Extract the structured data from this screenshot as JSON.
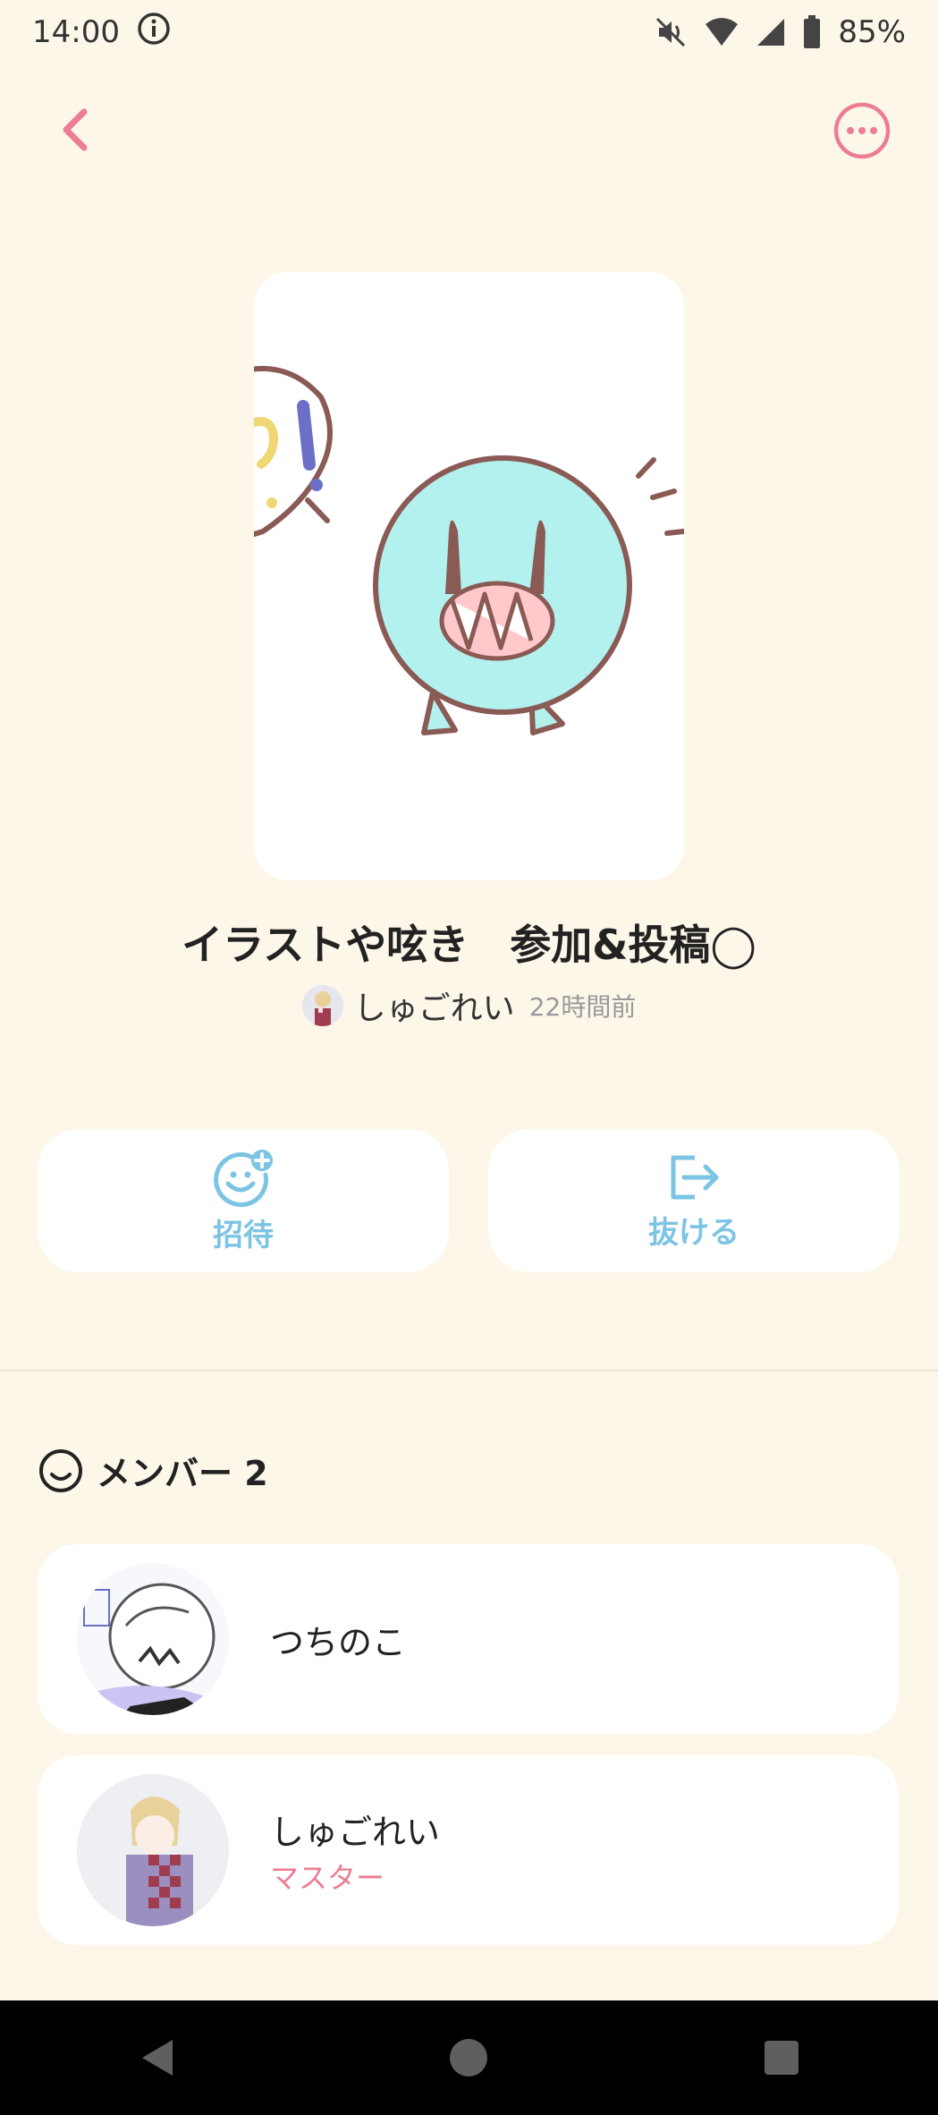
{
  "status": {
    "time": "14:00",
    "battery": "85%"
  },
  "room": {
    "title": "イラストや呟き　参加&投稿◯",
    "owner_name": "しゅごれい",
    "time_ago": "22時間前"
  },
  "actions": {
    "invite_label": "招待",
    "leave_label": "抜ける"
  },
  "members": {
    "header": "メンバー 2",
    "list": [
      {
        "name": "つちのこ",
        "role": ""
      },
      {
        "name": "しゅごれい",
        "role": "マスター"
      }
    ]
  },
  "colors": {
    "background": "#fdf7e9",
    "accent_pink": "#ec7d93",
    "accent_blue": "#7cc4e3"
  }
}
